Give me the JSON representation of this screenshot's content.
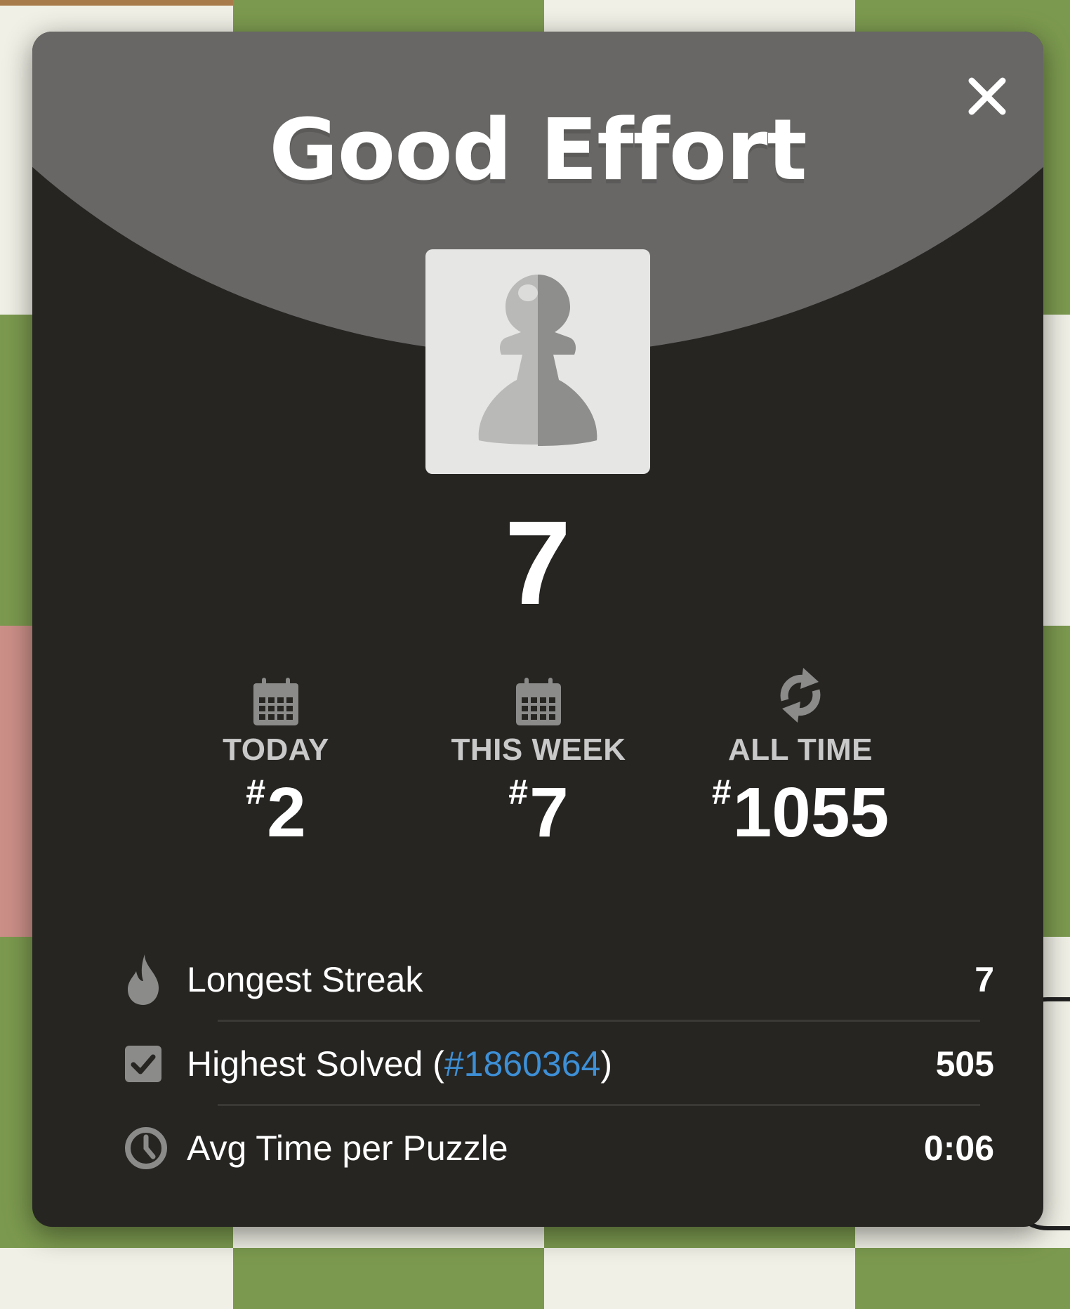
{
  "modal": {
    "title": "Good Effort",
    "score": "7",
    "close_icon": "close-icon",
    "piece_icon": "pawn-icon"
  },
  "rankings": [
    {
      "icon": "calendar-icon",
      "label": "TODAY",
      "hash": "#",
      "value": "2"
    },
    {
      "icon": "calendar-icon",
      "label": "THIS WEEK",
      "hash": "#",
      "value": "7"
    },
    {
      "icon": "refresh-icon",
      "label": "ALL TIME",
      "hash": "#",
      "value": "1055"
    }
  ],
  "stats": {
    "longest_streak": {
      "icon": "flame-icon",
      "label": "Longest Streak",
      "value": "7"
    },
    "highest_solved": {
      "icon": "checkbox-icon",
      "label_prefix": "Highest Solved (",
      "link": "#1860364",
      "label_suffix": ")",
      "value": "505"
    },
    "avg_time": {
      "icon": "clock-icon",
      "label": "Avg Time per Puzzle",
      "value": "0:06"
    }
  },
  "colors": {
    "modal_bg": "#262522",
    "header_bg": "#686766",
    "link": "#3d8fd6",
    "board_green": "#7c9a4f",
    "board_light": "#f0f0e6"
  }
}
